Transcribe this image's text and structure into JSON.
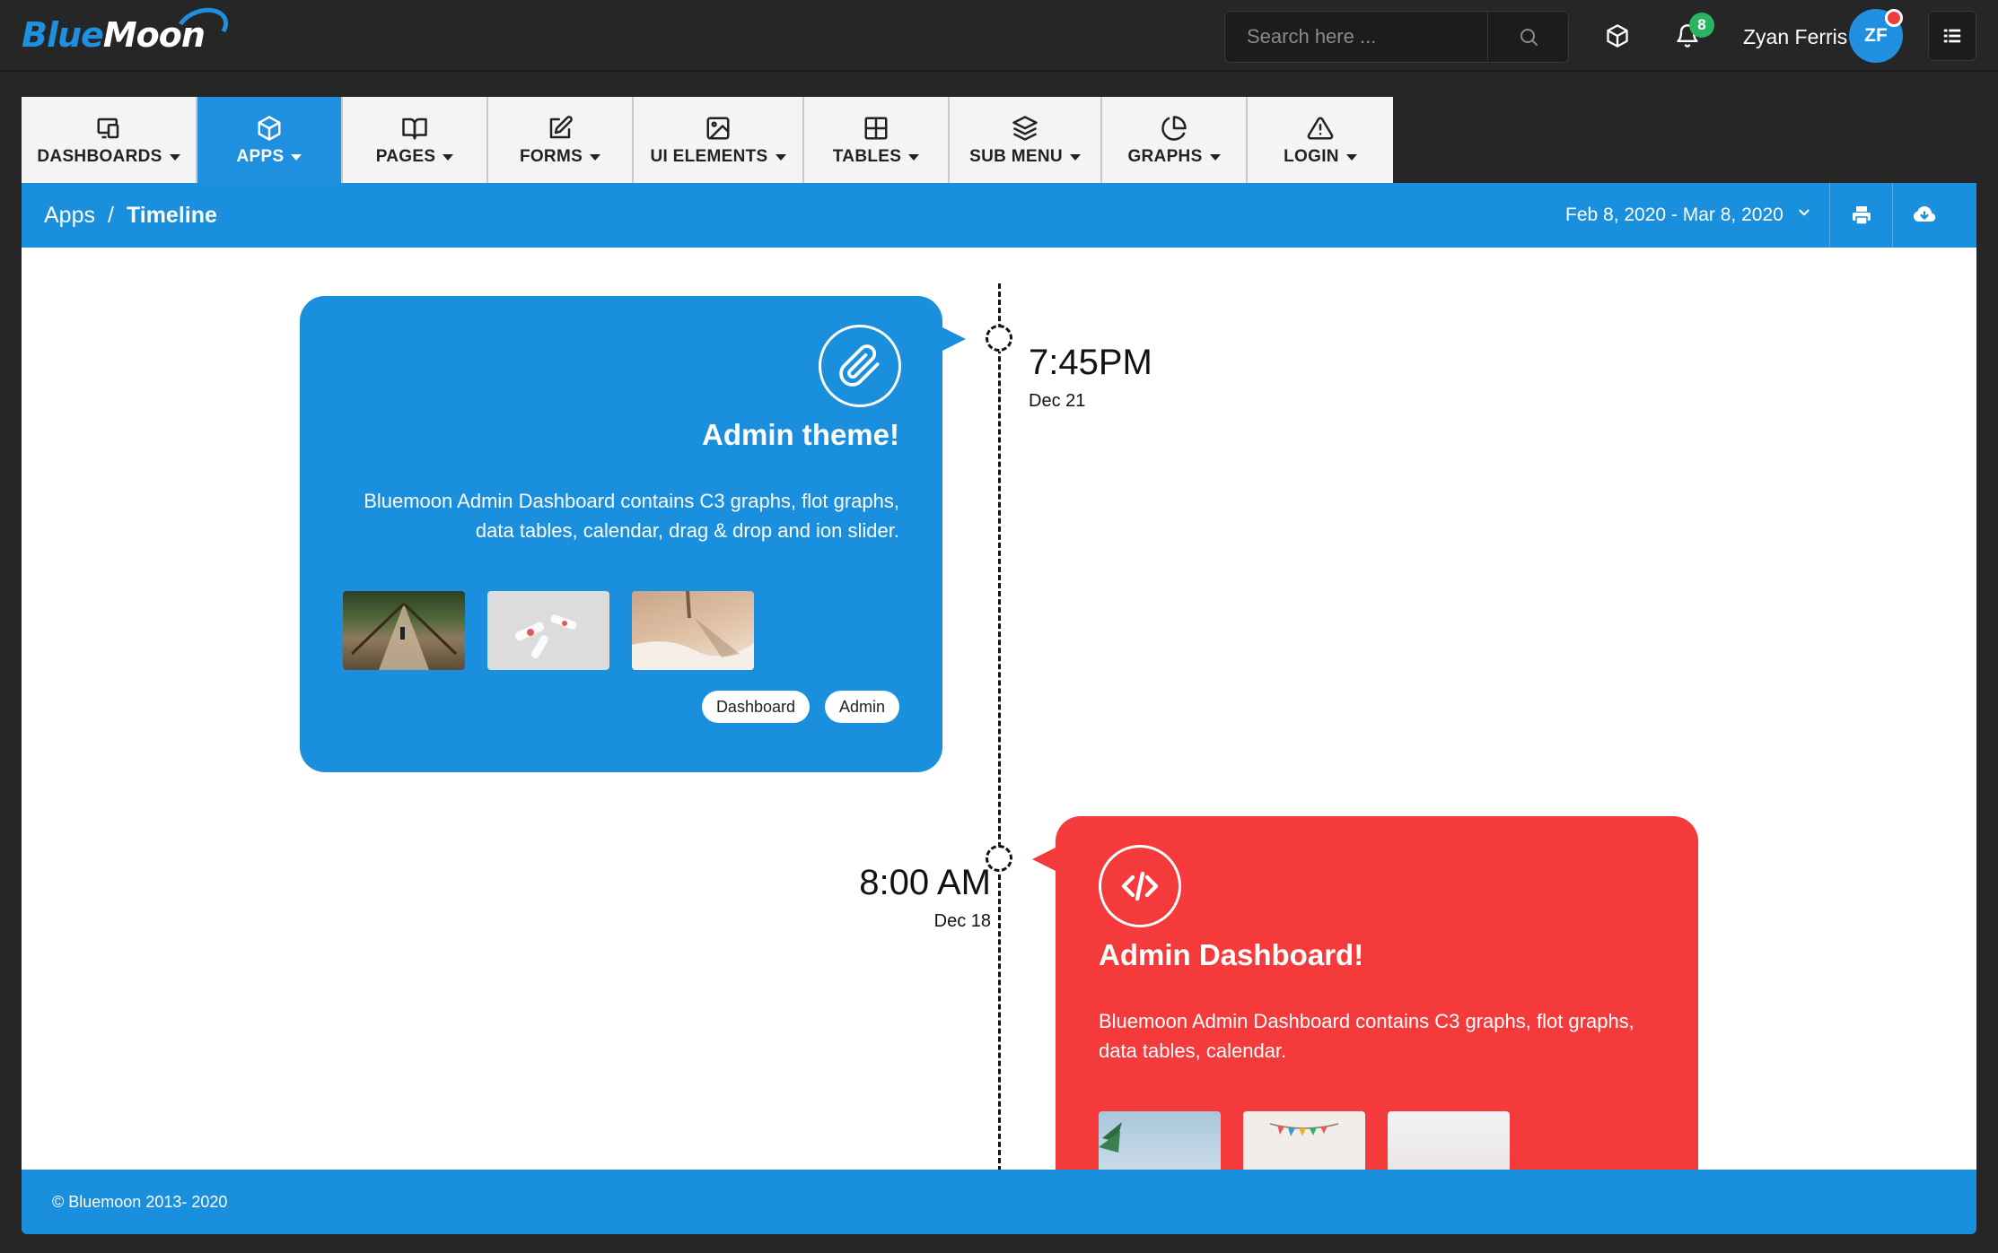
{
  "brand": {
    "part1": "Blue",
    "part2": "Moon"
  },
  "search": {
    "placeholder": "Search here ..."
  },
  "header": {
    "notification_count": "8",
    "user_name": "Zyan Ferris",
    "user_initials": "ZF"
  },
  "nav": {
    "items": [
      {
        "label": "DASHBOARDS",
        "icon": "devices-icon"
      },
      {
        "label": "APPS",
        "icon": "box-icon",
        "active": true
      },
      {
        "label": "PAGES",
        "icon": "book-icon"
      },
      {
        "label": "FORMS",
        "icon": "edit-icon"
      },
      {
        "label": "UI ELEMENTS",
        "icon": "image-icon"
      },
      {
        "label": "TABLES",
        "icon": "grid-icon"
      },
      {
        "label": "SUB MENU",
        "icon": "layers-icon"
      },
      {
        "label": "GRAPHS",
        "icon": "pie-chart-icon"
      },
      {
        "label": "LOGIN",
        "icon": "alert-triangle-icon"
      }
    ]
  },
  "breadcrumb": {
    "parent": "Apps",
    "separator": "/",
    "current": "Timeline"
  },
  "date_range": "Feb 8, 2020 - Mar 8, 2020",
  "timeline": [
    {
      "time": "7:45PM",
      "date": "Dec 21",
      "title": "Admin theme!",
      "text": "Bluemoon Admin Dashboard contains C3 graphs, flot graphs, data tables, calendar, drag & drop and ion slider.",
      "tags": [
        "Dashboard",
        "Admin"
      ],
      "color": "#1a8fde",
      "icon": "paperclip-icon"
    },
    {
      "time": "8:00 AM",
      "date": "Dec 18",
      "title": "Admin Dashboard!",
      "text": "Bluemoon Admin Dashboard contains C3 graphs, flot graphs, data tables, calendar.",
      "color": "#f43a3a",
      "icon": "code-icon"
    }
  ],
  "footer": {
    "text": "© Bluemoon 2013- 2020"
  },
  "colors": {
    "accent": "#1a8fde",
    "danger": "#f43a3a",
    "success": "#28b463",
    "dark": "#262626"
  }
}
